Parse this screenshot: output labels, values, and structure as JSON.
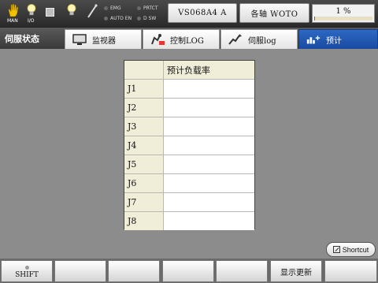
{
  "status": {
    "man_label": "MAN",
    "io_label": "I/O",
    "indicators": [
      {
        "label": "EMG"
      },
      {
        "label": "PRTCT"
      },
      {
        "label": "AUTO EN"
      },
      {
        "label": "D SW"
      }
    ],
    "robot_model": "VS068A4 A",
    "axis_mode": "各轴  WOTO",
    "speed_text": "1 %",
    "speed_level": 0.01
  },
  "tabs": {
    "page_title": "伺服状态",
    "items": [
      {
        "label": "监视器",
        "icon": "monitor-icon"
      },
      {
        "label": "控制LOG",
        "icon": "control-log-icon"
      },
      {
        "label": "伺服log",
        "icon": "servo-log-icon"
      },
      {
        "label": "预计",
        "icon": "estimate-icon"
      }
    ],
    "active_index": 3
  },
  "table": {
    "header": "预计负载率",
    "rows": [
      {
        "joint": "J1",
        "value": ""
      },
      {
        "joint": "J2",
        "value": ""
      },
      {
        "joint": "J3",
        "value": ""
      },
      {
        "joint": "J4",
        "value": ""
      },
      {
        "joint": "J5",
        "value": ""
      },
      {
        "joint": "J6",
        "value": ""
      },
      {
        "joint": "J7",
        "value": ""
      },
      {
        "joint": "J8",
        "value": ""
      }
    ]
  },
  "shortcut_label": "Shortcut",
  "function_keys": [
    "SHIFT",
    "",
    "",
    "",
    "",
    "显示更新",
    ""
  ],
  "colors": {
    "active_tab": "#1a4aa0",
    "table_label_bg": "#f0eed8",
    "background": "#8c8c8c"
  }
}
